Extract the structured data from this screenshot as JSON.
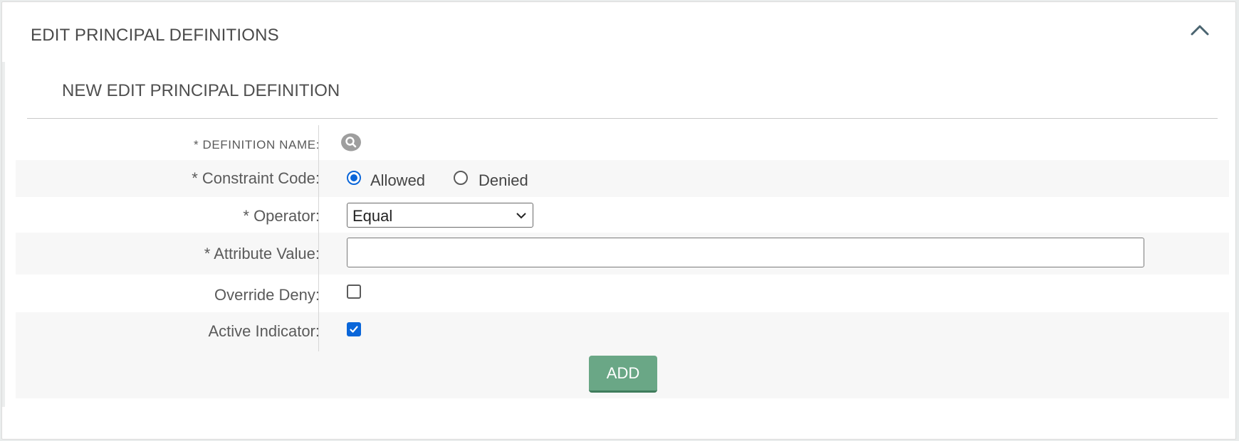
{
  "panel": {
    "title": "EDIT PRINCIPAL DEFINITIONS",
    "collapse_icon": "chevron-up-icon"
  },
  "section": {
    "title": "NEW EDIT PRINCIPAL DEFINITION"
  },
  "form": {
    "definition_name": {
      "label": "* DEFINITION NAME:",
      "icon": "search-icon"
    },
    "constraint_code": {
      "label": "* Constraint Code:",
      "options": [
        {
          "label": "Allowed",
          "selected": true
        },
        {
          "label": "Denied",
          "selected": false
        }
      ]
    },
    "operator": {
      "label": "* Operator:",
      "value": "Equal"
    },
    "attribute_value": {
      "label": "* Attribute Value:",
      "value": "",
      "placeholder": ""
    },
    "override_deny": {
      "label": "Override Deny:",
      "checked": false
    },
    "active_indicator": {
      "label": "Active Indicator:",
      "checked": true
    },
    "add_button": {
      "label": "ADD"
    }
  },
  "colors": {
    "accent_blue": "#0a66d9",
    "add_button_green": "#6aa786",
    "row_shade": "#f7f7f7"
  }
}
